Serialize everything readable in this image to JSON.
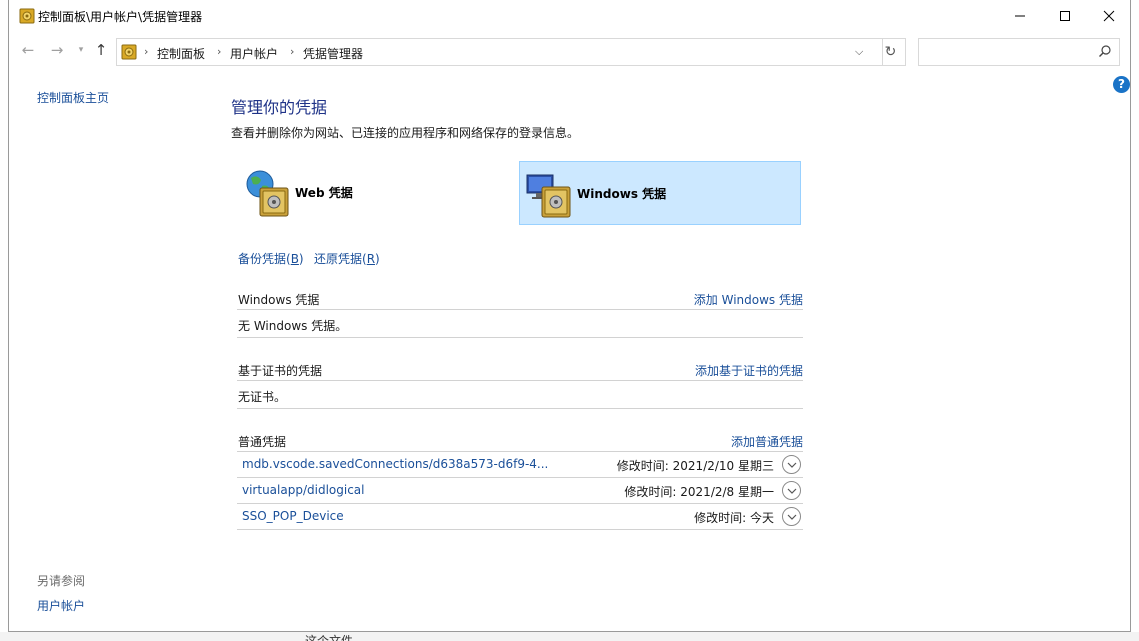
{
  "window": {
    "title": "控制面板\\用户帐户\\凭据管理器"
  },
  "address": {
    "crumbs": [
      "控制面板",
      "用户帐户",
      "凭据管理器"
    ],
    "search_placeholder": ""
  },
  "left_nav": {
    "home": "控制面板主页",
    "see_also": "另请参阅",
    "user_accounts": "用户帐户"
  },
  "main": {
    "heading": "管理你的凭据",
    "description": "查看并删除你为网站、已连接的应用程序和网络保存的登录信息。",
    "cred_types": [
      {
        "label": "Web 凭据",
        "selected": false
      },
      {
        "label": "Windows 凭据",
        "selected": true
      }
    ],
    "backup_link_prefix": "备份凭据(",
    "backup_link_key": "B",
    "backup_link_suffix": ")",
    "restore_link_prefix": "还原凭据(",
    "restore_link_key": "R",
    "restore_link_suffix": ")",
    "sections": {
      "windows": {
        "title": "Windows 凭据",
        "add": "添加 Windows 凭据",
        "empty": "无 Windows 凭据。"
      },
      "certificate": {
        "title": "基于证书的凭据",
        "add": "添加基于证书的凭据",
        "empty": "无证书。"
      },
      "generic": {
        "title": "普通凭据",
        "add": "添加普通凭据",
        "items": [
          {
            "name": "mdb.vscode.savedConnections/d638a573-d6f9-4...",
            "modified": "修改时间:  2021/2/10 星期三"
          },
          {
            "name": "virtualapp/didlogical",
            "modified": "修改时间:  2021/2/8 星期一"
          },
          {
            "name": "SSO_POP_Device",
            "modified": "修改时间:  今天"
          }
        ]
      }
    }
  },
  "background": {
    "bottom_text": "这个文件"
  },
  "colors": {
    "link": "#1a4f99",
    "heading": "#1e3287",
    "selected_bg": "#cce8ff",
    "help": "#1a73c7"
  },
  "icons": [
    "control-panel-icon",
    "minimize-icon",
    "maximize-icon",
    "close-icon",
    "back-arrow-icon",
    "forward-arrow-icon",
    "up-arrow-icon",
    "refresh-icon",
    "search-icon",
    "help-icon",
    "web-credential-icon",
    "windows-credential-icon",
    "expand-chevron-icon"
  ]
}
